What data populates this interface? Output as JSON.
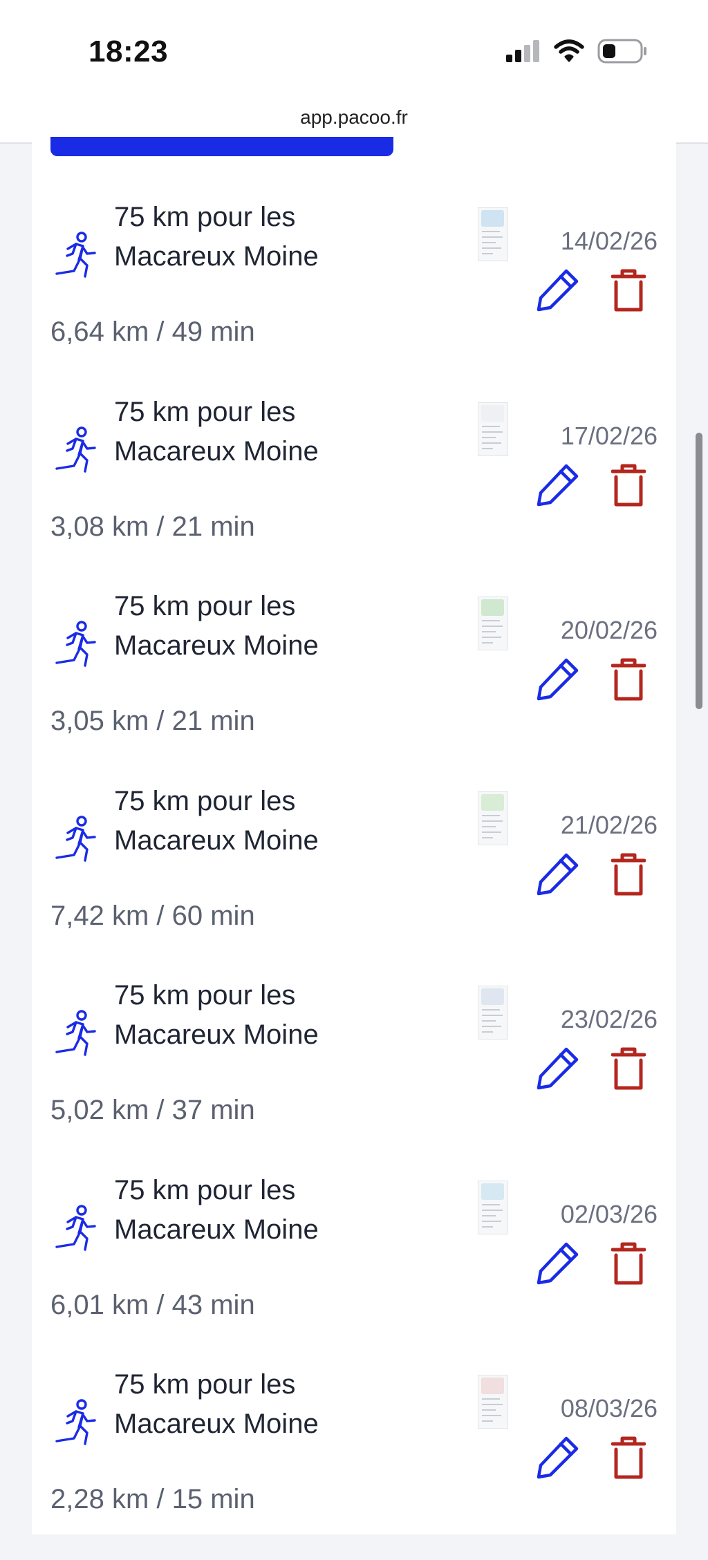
{
  "status_bar": {
    "time": "18:23"
  },
  "browser": {
    "url": "app.pacoo.fr"
  },
  "colors": {
    "accent": "#1a2be6",
    "delete": "#b3261e",
    "title": "#1f2533",
    "meta": "#5b6170"
  },
  "activities": [
    {
      "title": "75 km pour les Macareux Moine",
      "meta": "6,64 km / 49 min",
      "date": "14/02/26",
      "thumb_map": "#cfe3f2",
      "icon": "running-person-icon"
    },
    {
      "title": "75 km pour les Macareux Moine",
      "meta": "3,08 km / 21 min",
      "date": "17/02/26",
      "thumb_map": "#eef0f3",
      "icon": "running-person-icon"
    },
    {
      "title": "75 km pour les Macareux Moine",
      "meta": "3,05 km / 21 min",
      "date": "20/02/26",
      "thumb_map": "#cfe8cf",
      "icon": "running-person-icon"
    },
    {
      "title": "75 km pour les Macareux Moine",
      "meta": "7,42 km / 60 min",
      "date": "21/02/26",
      "thumb_map": "#d9ecd6",
      "icon": "running-person-icon"
    },
    {
      "title": "75 km pour les Macareux Moine",
      "meta": "5,02 km / 37 min",
      "date": "23/02/26",
      "thumb_map": "#dfe6ef",
      "icon": "running-person-icon"
    },
    {
      "title": "75 km pour les Macareux Moine",
      "meta": "6,01 km / 43 min",
      "date": "02/03/26",
      "thumb_map": "#d6e8f1",
      "icon": "running-person-icon"
    },
    {
      "title": "75 km pour les Macareux Moine",
      "meta": "2,28 km / 15 min",
      "date": "08/03/26",
      "thumb_map": "#f1dede",
      "icon": "running-person-icon"
    }
  ]
}
